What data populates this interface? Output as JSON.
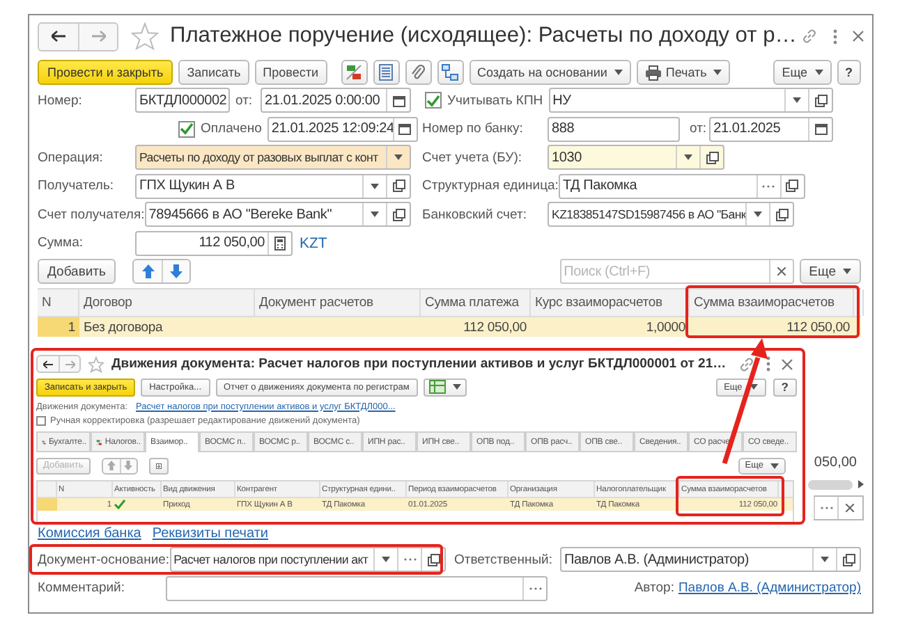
{
  "window": {
    "title": "Платежное поручение (исходящее): Расчеты по доходу от р…"
  },
  "toolbar": [
    {
      "kind": "primary",
      "label": "Провести и закрыть"
    },
    {
      "kind": "button",
      "label": "Записать"
    },
    {
      "kind": "button",
      "label": "Провести"
    },
    {
      "kind": "icon"
    },
    {
      "kind": "icon"
    },
    {
      "kind": "icon"
    },
    {
      "kind": "icon"
    },
    {
      "kind": "menu",
      "label": "Создать на основании"
    },
    {
      "kind": "print-menu",
      "label": "Печать"
    }
  ],
  "toolbar_more": "Еще",
  "toolbar_help": "?",
  "form": {
    "number": {
      "label": "Номер:",
      "value": "БКТДЛ000002"
    },
    "date": {
      "label": "от:",
      "value": "21.01.2025  0:00:00"
    },
    "kpn": {
      "label": "Учитывать КПН",
      "checked": true,
      "value": "НУ"
    },
    "paid": {
      "label": "Оплачено",
      "checked": true,
      "value": "21.01.2025 12:09:24"
    },
    "bank_number": {
      "label": "Номер по банку:",
      "value": "888"
    },
    "bank_date": {
      "label": "от:",
      "value": "21.01.2025"
    },
    "operation": {
      "label": "Операция:",
      "value": "Расчеты по доходу от разовых выплат с конт",
      "kind": "warning"
    },
    "account": {
      "label": "Счет учета (БУ):",
      "value": "1030",
      "kind": "current"
    },
    "recipient": {
      "label": "Получатель:",
      "value": "ГПХ Щукин А В"
    },
    "unit": {
      "label": "Структурная единица:",
      "value": "ТД Пакомка"
    },
    "recipient_account": {
      "label": "Счет получателя:",
      "value": "78945666 в АО \"Bereke Bank\""
    },
    "bank_account": {
      "label": "Банковский счет:",
      "value": "KZ18385147SD15987456 в АО \"Банк"
    },
    "amount": {
      "label": "Сумма:",
      "value": "112 050,00",
      "currency": "KZT"
    }
  },
  "table_bar": {
    "add": "Добавить",
    "search_placeholder": "Поиск (Ctrl+F)",
    "more": "Еще"
  },
  "table": {
    "columns": [
      "N",
      "Договор",
      "Документ расчетов",
      "Сумма платежа",
      "Курс взаиморасчетов",
      "Сумма взаиморасчетов"
    ],
    "rows": [
      {
        "selected": true,
        "cells": [
          "1",
          "Без договора",
          null,
          "112 050,00",
          "1,0000",
          "112 050,00"
        ]
      }
    ]
  },
  "hidden_total": "050,00",
  "movements_window": {
    "title": "Движения документа: Расчет налогов при поступлении активов и услуг БКТДЛ000001 от 21…",
    "toolbar": [
      {
        "kind": "primary",
        "label": "Записать и закрыть"
      },
      {
        "kind": "button",
        "label": "Настройка..."
      },
      {
        "kind": "button",
        "label": "Отчет о движениях документа по регистрам"
      },
      {
        "kind": "icon-menu"
      }
    ],
    "more": "Еще",
    "help": "?",
    "document": {
      "label": "Движения документа:",
      "link": "Расчет налогов при поступлении активов и услуг БКТДЛ000..."
    },
    "manual": {
      "label": "Ручная корректировка (разрешает редактирование движений документа)",
      "checked": false
    },
    "tabs": [
      {
        "label": "Бухгалте..",
        "kind": "ledger",
        "selected": false
      },
      {
        "label": "Налогов..",
        "kind": "ledger",
        "selected": false
      },
      {
        "label": "Взаимор..",
        "kind": "plain",
        "selected": true
      },
      {
        "label": "ВОСМС п..",
        "kind": "plain",
        "selected": false
      },
      {
        "label": "ВОСМС р..",
        "kind": "plain",
        "selected": false
      },
      {
        "label": "ВОСМС с..",
        "kind": "plain",
        "selected": false
      },
      {
        "label": "ИПН рас..",
        "kind": "plain",
        "selected": false
      },
      {
        "label": "ИПН све..",
        "kind": "plain",
        "selected": false
      },
      {
        "label": "ОПВ под..",
        "kind": "plain",
        "selected": false
      },
      {
        "label": "ОПВ расч..",
        "kind": "plain",
        "selected": false
      },
      {
        "label": "ОПВ све..",
        "kind": "plain",
        "selected": false
      },
      {
        "label": "Сведения..",
        "kind": "plain",
        "selected": false
      },
      {
        "label": "СО расче",
        "kind": "plain",
        "selected": false
      },
      {
        "label": "СО сведе..",
        "kind": "plain",
        "selected": false
      }
    ],
    "add": {
      "label": "Добавить",
      "disabled": true
    },
    "table_more": "Еще",
    "table": {
      "columns": [
        "N",
        "Активность",
        "Вид движения",
        "Контрагент",
        "Структурная едини..",
        "Период взаиморасчетов",
        "Организация",
        "Налогоплательщик",
        "Сумма взаиморасчетов"
      ],
      "rows": [
        {
          "selected": true,
          "active": true,
          "cells": [
            "1",
            null,
            "Приход",
            "ГПХ Щукин А В",
            "ТД Пакомка",
            "01.01.2025",
            "ТД Пакомка",
            "ТД Пакомка",
            "112 050,00"
          ]
        }
      ]
    }
  },
  "links": [
    "Комиссия банка",
    "Реквизиты печати"
  ],
  "basis": {
    "label": "Документ-основание:",
    "value": "Расчет налогов при поступлении акт"
  },
  "responsible": {
    "label": "Ответственный:",
    "value": "Павлов А.В. (Администратор)"
  },
  "comment": {
    "label": "Комментарий:"
  },
  "author": {
    "label": "Автор:",
    "link": "Павлов А.В. (Администратор)"
  }
}
